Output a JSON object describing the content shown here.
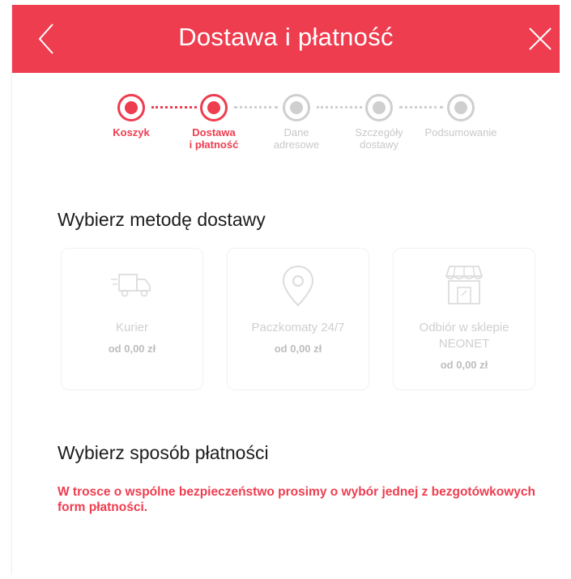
{
  "header": {
    "title": "Dostawa i płatność",
    "back_icon": "chevron-left-icon",
    "close_icon": "close-icon",
    "background_color": "#ee3d4f"
  },
  "stepper": {
    "steps": [
      {
        "label": "Koszyk",
        "state": "done"
      },
      {
        "label": "Dostawa\ni płatność",
        "state": "current"
      },
      {
        "label": "Dane\nadresowe",
        "state": "pending"
      },
      {
        "label": "Szczegóły\ndostawy",
        "state": "pending"
      },
      {
        "label": "Podsumowanie",
        "state": "pending"
      }
    ],
    "active_color": "#ee3d4f",
    "inactive_color": "#cfcfcf"
  },
  "delivery": {
    "title": "Wybierz metodę dostawy",
    "options": [
      {
        "name": "Kurier",
        "price": "od 0,00 zł",
        "icon": "truck-icon"
      },
      {
        "name": "Paczkomaty 24/7",
        "price": "od 0,00 zł",
        "icon": "location-pin-icon"
      },
      {
        "name": "Odbiór w sklepie\nNEONET",
        "price": "od 0,00 zł",
        "icon": "store-icon"
      }
    ]
  },
  "payment": {
    "title": "Wybierz sposób płatności",
    "notice": "W trosce o wspólne bezpieczeństwo prosimy o wybór jednej z bezgotówkowych form płatności."
  }
}
